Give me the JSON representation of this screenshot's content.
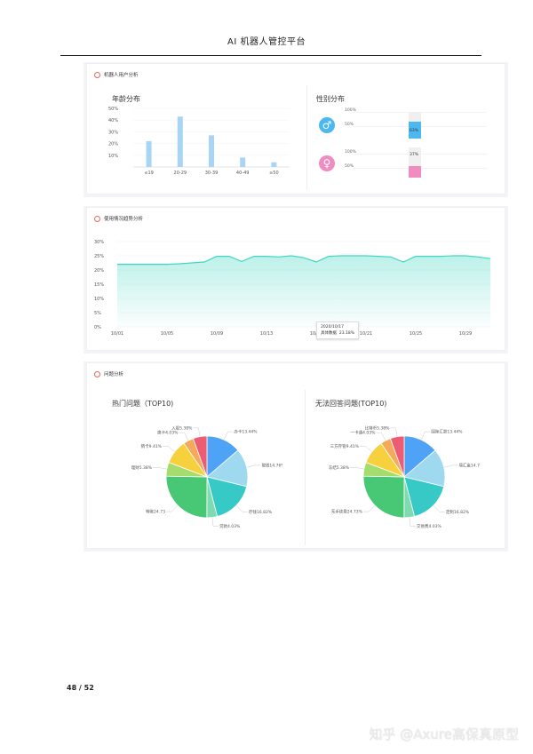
{
  "doc_title": "AI 机器人管控平台",
  "page_number": "48 / 52",
  "watermark": "知乎 @Axure高保真原型",
  "section_user": {
    "heading": "机器人用户分析",
    "age_title": "年龄分布",
    "gender_title": "性别分布"
  },
  "section_usage": {
    "heading": "使用情况趋势分析",
    "tooltip_date": "2020/10/17",
    "tooltip_label": "具体数据",
    "tooltip_value": "23.18%"
  },
  "section_issue": {
    "heading": "问题分析",
    "hot_title": "热门问题（TOP10)",
    "unanswered_title": "无法回答问题(TOP10)"
  },
  "gender": {
    "male": {
      "value": 63,
      "label": "63%",
      "ticks": [
        "100%",
        "50%"
      ],
      "color": "#4db8f0"
    },
    "female": {
      "value": 37,
      "label": "37%",
      "ticks": [
        "100%",
        "50%"
      ],
      "color": "#f08cc0"
    }
  },
  "chart_data": [
    {
      "type": "bar",
      "title": "年龄分布",
      "categories": [
        "≤19",
        "20-29",
        "30-39",
        "40-49",
        "≥50"
      ],
      "values": [
        22,
        43,
        27,
        8,
        4
      ],
      "y_ticks": [
        "10%",
        "20%",
        "30%",
        "40%",
        "50%"
      ],
      "ylim": [
        0,
        50
      ],
      "color": "#a8d4f5"
    },
    {
      "type": "area",
      "title": "使用情况趋势分析",
      "x_ticks": [
        "10/01",
        "10/05",
        "10/09",
        "10/13",
        "10/17",
        "10/21",
        "10/25",
        "10/29"
      ],
      "y_ticks": [
        "0%",
        "5%",
        "10%",
        "15%",
        "20%",
        "25%",
        "30%"
      ],
      "ylim": [
        0,
        30
      ],
      "x": [
        1,
        2,
        3,
        4,
        5,
        6,
        7,
        8,
        9,
        10,
        11,
        12,
        13,
        14,
        15,
        16,
        17,
        18,
        19,
        20,
        21,
        22,
        23,
        24,
        25,
        26,
        27,
        28,
        29,
        30,
        31
      ],
      "values": [
        22,
        22,
        22,
        22,
        22,
        22.2,
        22.5,
        22.8,
        24.8,
        24.8,
        23,
        24.8,
        24.8,
        24.6,
        25,
        24.3,
        22.8,
        24.8,
        25,
        25,
        25,
        24.8,
        24.6,
        22.8,
        24.8,
        24.8,
        24.8,
        25,
        25,
        24.6,
        24
      ],
      "highlight": {
        "date": "2020/10/17",
        "value": 23.18
      },
      "color": "#3ed6c0"
    },
    {
      "type": "pie",
      "title": "热门问题（TOP10)",
      "slices": [
        {
          "label": "办卡13.44%",
          "value": 13.44,
          "color": "#4fa3f7"
        },
        {
          "label": "取钱14.76%",
          "value": 14.76,
          "color": "#9ed9ef"
        },
        {
          "label": "存钱16.82%",
          "value": 16.82,
          "color": "#36c9c6"
        },
        {
          "label": "贷款4.03%",
          "value": 4.03,
          "color": "#7fdab0"
        },
        {
          "label": "转账24.73",
          "value": 24.73,
          "color": "#48c774"
        },
        {
          "label": "理财5.38%",
          "value": 5.38,
          "color": "#a6dc6e"
        },
        {
          "label": "销卡9.41%",
          "value": 9.41,
          "color": "#f7d13d"
        },
        {
          "label": "换卡4.03%",
          "value": 4.03,
          "color": "#f5a95a"
        },
        {
          "label": "入股5.38%",
          "value": 5.38,
          "color": "#ee5c73"
        }
      ]
    },
    {
      "type": "pie",
      "title": "无法回答问题(TOP10)",
      "slices": [
        {
          "label": "国际汇款13.44%",
          "value": 13.44,
          "color": "#4fa3f7"
        },
        {
          "label": "境汇金14.76%",
          "value": 14.76,
          "color": "#9ed9ef"
        },
        {
          "label": "定制16.82%",
          "value": 16.82,
          "color": "#36c9c6"
        },
        {
          "label": "交易费4.03%",
          "value": 4.03,
          "color": "#7fdab0"
        },
        {
          "label": "无手续费24.73%",
          "value": 24.73,
          "color": "#48c774"
        },
        {
          "label": "冻结5.38%",
          "value": 5.38,
          "color": "#a6dc6e"
        },
        {
          "label": "三方存管9.41%",
          "value": 9.41,
          "color": "#f7d13d"
        },
        {
          "label": "一卡通4.03%",
          "value": 4.03,
          "color": "#f5a95a"
        },
        {
          "label": "比特币5.38%",
          "value": 5.38,
          "color": "#ee5c73"
        }
      ]
    }
  ]
}
